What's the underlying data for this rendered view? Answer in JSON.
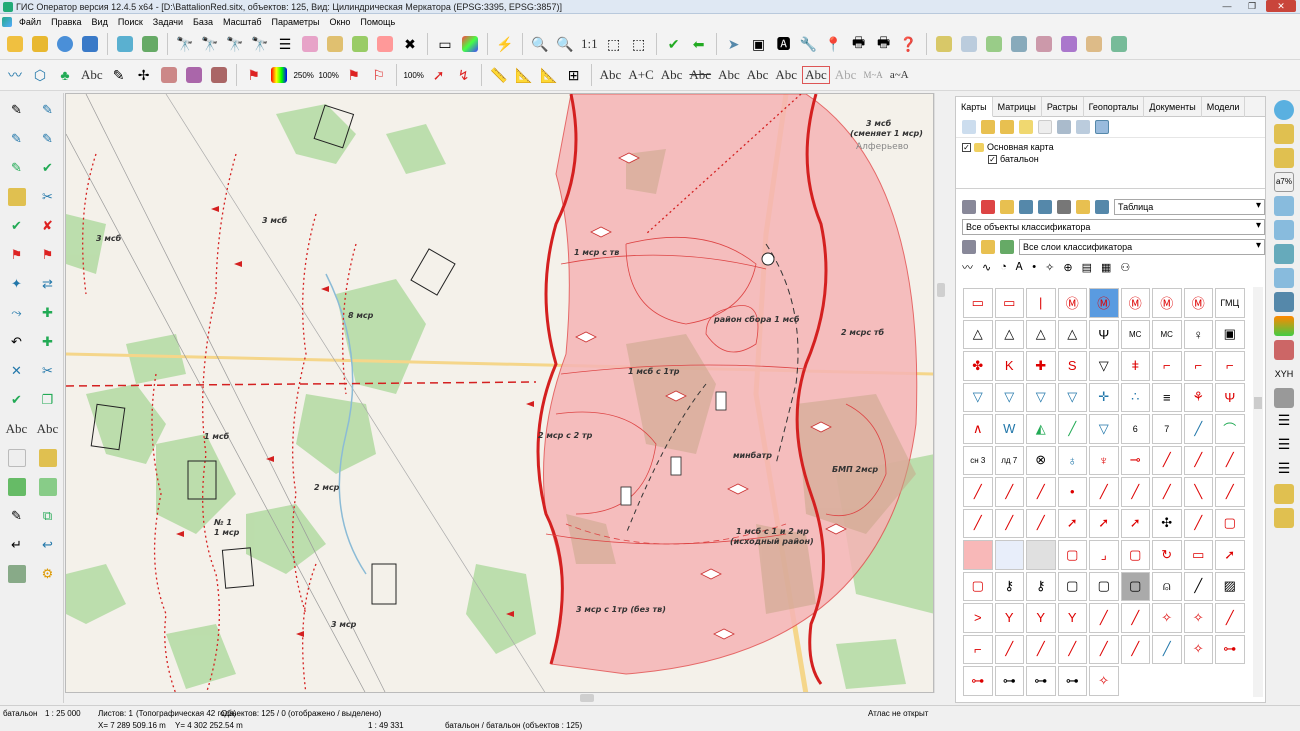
{
  "window": {
    "title": "ГИС Оператор версия 12.4.5 x64 - [D:\\BattalionRed.sitx, объектов: 125, Вид: Цилиндрическая Меркатора (EPSG:3395, EPSG:3857)]"
  },
  "menu": [
    "Файл",
    "Правка",
    "Вид",
    "Поиск",
    "Задачи",
    "База",
    "Масштаб",
    "Параметры",
    "Окно",
    "Помощь"
  ],
  "toolbar": {
    "zoom_ratio": "1:1",
    "text_abc": "Abc",
    "scale_label": "250%",
    "percent100": "100%",
    "percent100b": "100%",
    "text_tools": [
      "Abc",
      "A+C",
      "Abc",
      "Abc",
      "Abc",
      "Abc",
      "Abc",
      "Abc",
      "Abc",
      "M~A",
      "a~A"
    ]
  },
  "left_tools": {
    "abc1": "Abc",
    "abc2": "Abc"
  },
  "map": {
    "labels": {
      "msb3_left": "3 мсб",
      "msb3_top": "3 мсб",
      "msr8": "8 мср",
      "msb1": "1 мсб",
      "msr2": "2 мср",
      "no1": "№ 1",
      "msr1": "1 мср",
      "msr3": "3 мср",
      "msr1_tv": "1 мср с тв",
      "district": "район сбора 1 мсб",
      "msrtb2": "2 мсрс тб",
      "msb_1tr": "1 мсб с 1тр",
      "msr2_2tr": "2 мср с 2 тр",
      "minbatr": "минбатр",
      "bmp": "БМП 2мср",
      "msb1_12mr": "1 мсб с 1 и 2 мр",
      "iskhod": "(исходный район)",
      "msr3_tr": "3 мср с 1тр (без тв)",
      "msb3_top_right": "3 мсб",
      "smenyaet": "(сменяет 1 мср)",
      "alferevo": "Алферьево"
    }
  },
  "panel": {
    "tabs": [
      "Карты",
      "Матрицы",
      "Растры",
      "Геопорталы",
      "Документы",
      "Модели"
    ],
    "tree": {
      "root": "Основная карта",
      "child": "батальон"
    },
    "view_select": "Таблица",
    "objects_select": "Все объекты классификатора",
    "layers_select": "Все слои классификатора",
    "sym_gmc": "ГМЦ",
    "sym_mc": "МС",
    "sym_mc2": "МС",
    "sym_sn3": "сн 3",
    "sym_ld7": "лд 7",
    "sym_6": "6",
    "sym_7": "7"
  },
  "right_tools": {
    "a7": "a7%",
    "xyh": "XYH"
  },
  "status": {
    "layer": "батальон",
    "scale": "1 : 25 000",
    "sheets": "Листов: 1",
    "map_info": "(Топографическая 42 года)",
    "objects": "Объектов: 125 / 0 (отображено / выделено)",
    "atlas": "Атлас не открыт",
    "x": "X= 7 289 509.16 m",
    "y": "Y= 4 302 252.54 m",
    "scale2": "1 : 49 331",
    "layer2": "батальон / батальон  (объектов : 125)"
  },
  "colors": {
    "accent_red": "#e02020",
    "zone_fill": "#f6b4b6",
    "forest": "#a9d397",
    "road": "#f7d98c"
  }
}
